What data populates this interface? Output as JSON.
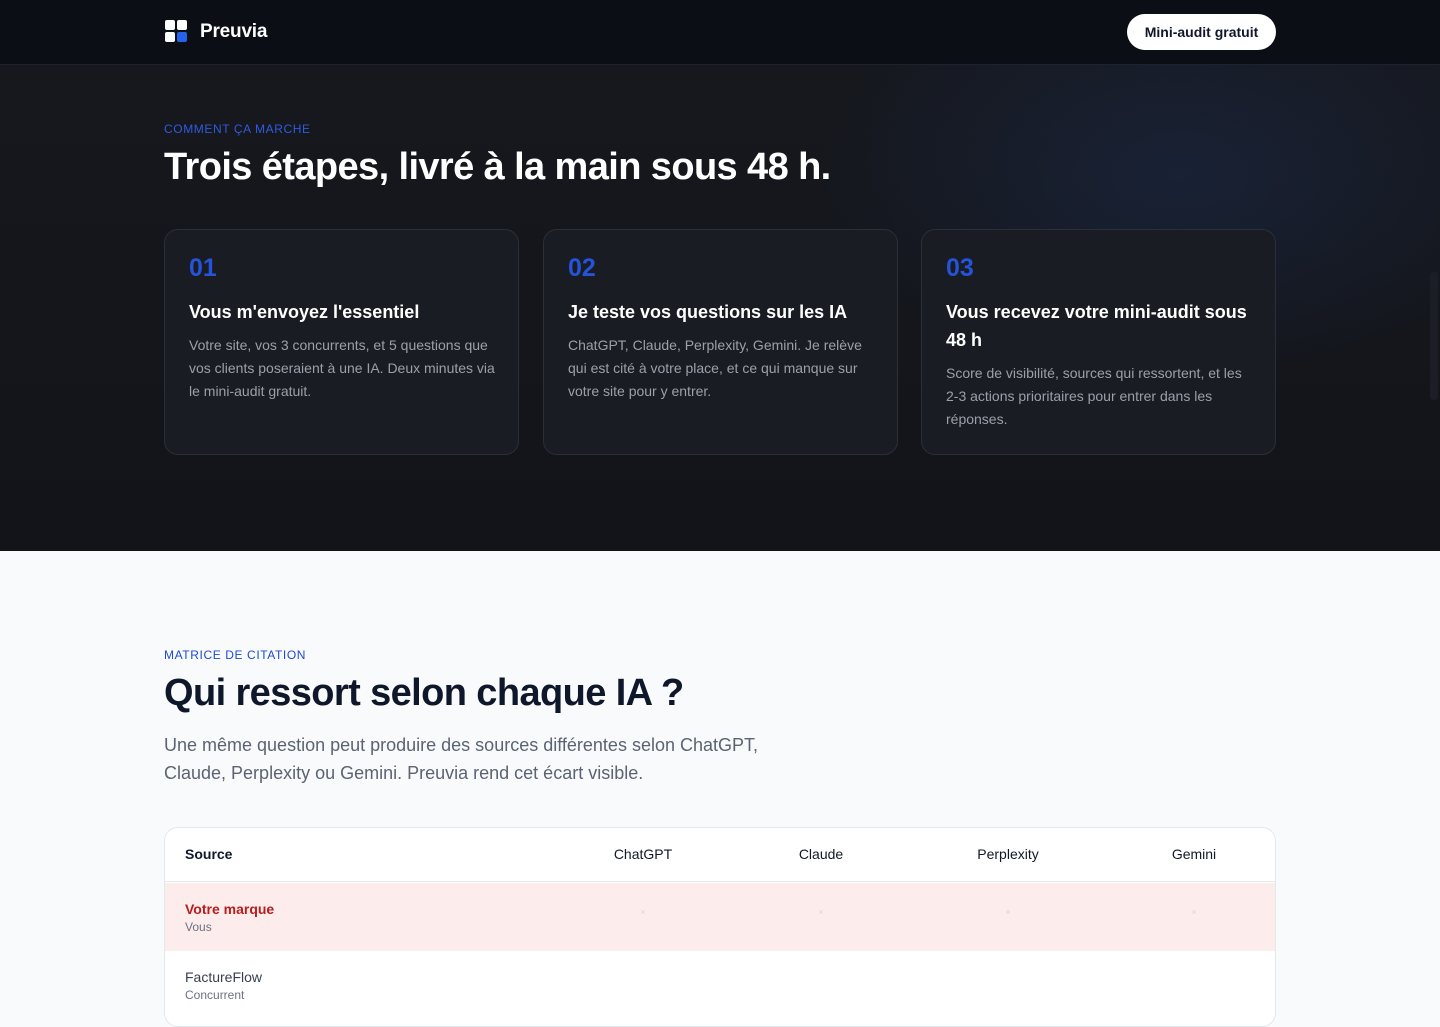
{
  "header": {
    "brand": "Preuvia",
    "cta_label": "Mini-audit gratuit"
  },
  "steps": {
    "eyebrow": "COMMENT ÇA MARCHE",
    "title": "Trois étapes, livré à la main sous 48 h.",
    "cards": [
      {
        "number": "01",
        "title": "Vous m'envoyez l'essentiel",
        "description": "Votre site, vos 3 concurrents, et 5 questions que vos clients poseraient à une IA. Deux minutes via le mini-audit gratuit."
      },
      {
        "number": "02",
        "title": "Je teste vos questions sur les IA",
        "description": "ChatGPT, Claude, Perplexity, Gemini. Je relève qui est cité à votre place, et ce qui manque sur votre site pour y entrer."
      },
      {
        "number": "03",
        "title": "Vous recevez votre mini-audit sous 48 h",
        "description": "Score de visibilité, sources qui ressortent, et les 2-3 actions prioritaires pour entrer dans les réponses."
      }
    ]
  },
  "matrix": {
    "eyebrow": "MATRICE DE CITATION",
    "title": "Qui ressort selon chaque IA ?",
    "lede": "Une même question peut produire des sources différentes selon ChatGPT, Claude, Perplexity ou Gemini. Preuvia rend cet écart visible.",
    "columns": [
      "Source",
      "ChatGPT",
      "Claude",
      "Perplexity",
      "Gemini"
    ],
    "rows": [
      {
        "name": "Votre marque",
        "sub": "Vous",
        "cells": [
          "×",
          "×",
          "×",
          "×"
        ]
      },
      {
        "name": "FactureFlow",
        "sub": "Concurrent",
        "cells": [
          "",
          "",
          "",
          ""
        ]
      }
    ]
  },
  "colors": {
    "accent": "#2553d9",
    "dark_bg": "#16181e",
    "highlight_row": "#fdecec",
    "brand_red": "#b91c1c"
  }
}
